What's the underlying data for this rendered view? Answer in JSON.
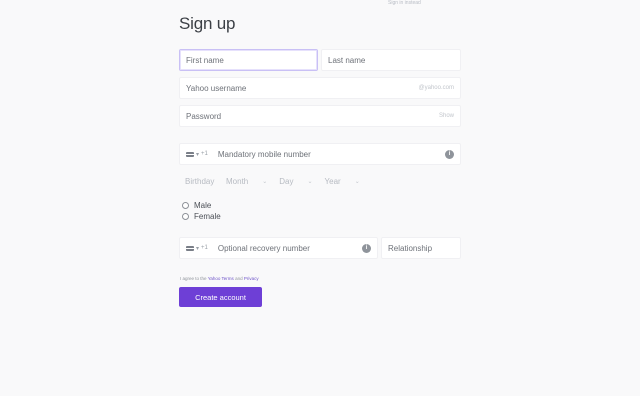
{
  "top_link": "Sign in instead",
  "title": "Sign up",
  "fields": {
    "first_name": {
      "placeholder": "First name"
    },
    "last_name": {
      "placeholder": "Last name"
    },
    "username": {
      "placeholder": "Yahoo username",
      "suffix": "@yahoo.com"
    },
    "password": {
      "placeholder": "Password",
      "suffix": "Show"
    },
    "mobile": {
      "country_code": "+1",
      "placeholder": "Mandatory mobile number"
    },
    "recovery": {
      "country_code": "+1",
      "placeholder": "Optional recovery number"
    },
    "relationship": {
      "placeholder": "Relationship"
    }
  },
  "birthday": {
    "label": "Birthday",
    "month": "Month",
    "day": "Day",
    "year": "Year"
  },
  "gender": {
    "male": "Male",
    "female": "Female"
  },
  "agree": {
    "prefix": "I agree to the",
    "terms": "Yahoo Terms",
    "and": "and",
    "privacy": "Privacy"
  },
  "create_button": "Create account",
  "icons": {
    "info": "info-icon",
    "chevron": "chevron-down-icon",
    "flag": "flag-icon"
  },
  "colors": {
    "accent": "#6e3fd6",
    "focus_border": "#c9c0f5"
  }
}
